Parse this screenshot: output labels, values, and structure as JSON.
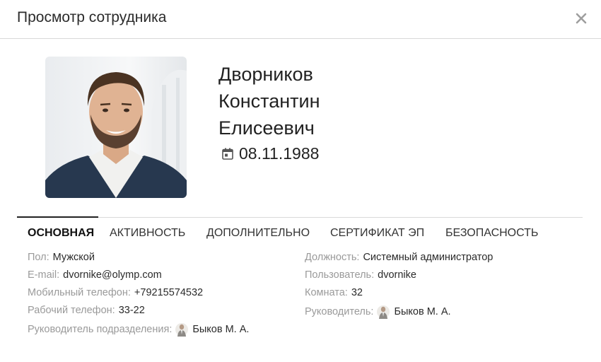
{
  "dialog": {
    "title": "Просмотр сотрудника",
    "close_icon": "close-icon"
  },
  "employee": {
    "last_name": "Дворников",
    "first_name": "Константин",
    "patronymic": "Елисеевич",
    "birth_date": "08.11.1988",
    "birth_date_icon": "calendar-icon"
  },
  "tabs": [
    {
      "label": "ОСНОВНАЯ",
      "active": true
    },
    {
      "label": "АКТИВНОСТЬ",
      "active": false
    },
    {
      "label": "ДОПОЛНИТЕЛЬНО",
      "active": false
    },
    {
      "label": "СЕРТИФИКАТ ЭП",
      "active": false
    },
    {
      "label": "БЕЗОПАСНОСТЬ",
      "active": false
    }
  ],
  "fields_left": [
    {
      "label": "Пол:",
      "value": "Мужской"
    },
    {
      "label": "E-mail:",
      "value": "dvornike@olymp.com"
    },
    {
      "label": "Мобильный телефон:",
      "value": "+79215574532"
    },
    {
      "label": "Рабочий телефон:",
      "value": "33-22"
    },
    {
      "label": "Руководитель подразделения:",
      "value": "Быков М. А."
    }
  ],
  "fields_right": [
    {
      "label": "Должность:",
      "value": "Системный администратор"
    },
    {
      "label": "Пользователь:",
      "value": "dvornike"
    },
    {
      "label": "Комната:",
      "value": "32"
    },
    {
      "label": "Руководитель:",
      "value": "Быков М. А."
    }
  ],
  "colors": {
    "label": "#9a9a9a",
    "value": "#2a2a2a",
    "divider": "#d9d9d9",
    "close_icon": "#9e9e9e"
  }
}
